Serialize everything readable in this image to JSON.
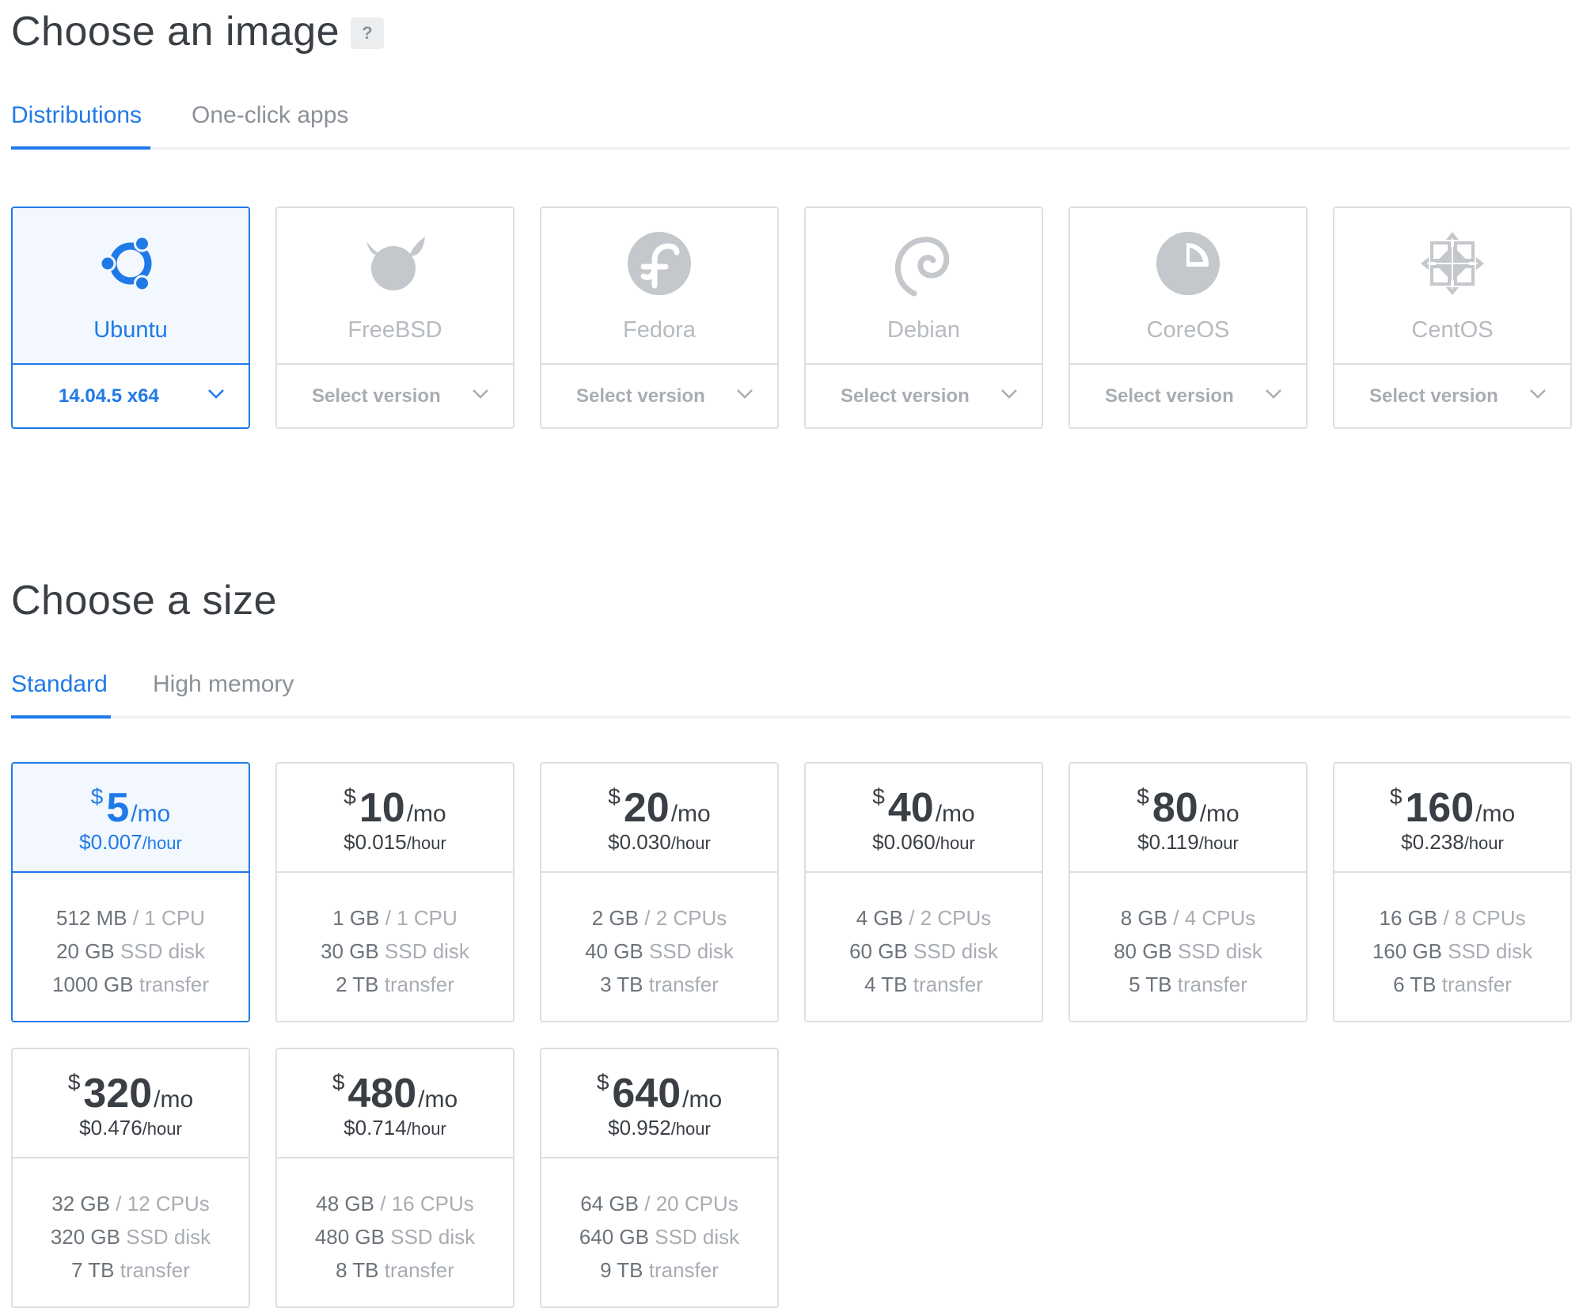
{
  "image_section": {
    "title": "Choose an image",
    "help_label": "?",
    "tabs": [
      {
        "label": "Distributions",
        "active": true
      },
      {
        "label": "One-click apps",
        "active": false
      }
    ],
    "distributions": [
      {
        "name": "Ubuntu",
        "icon": "ubuntu-icon",
        "version": "14.04.5 x64",
        "selected": true
      },
      {
        "name": "FreeBSD",
        "icon": "freebsd-icon",
        "version": "Select version",
        "selected": false
      },
      {
        "name": "Fedora",
        "icon": "fedora-icon",
        "version": "Select version",
        "selected": false
      },
      {
        "name": "Debian",
        "icon": "debian-icon",
        "version": "Select version",
        "selected": false
      },
      {
        "name": "CoreOS",
        "icon": "coreos-icon",
        "version": "Select version",
        "selected": false
      },
      {
        "name": "CentOS",
        "icon": "centos-icon",
        "version": "Select version",
        "selected": false
      }
    ]
  },
  "size_section": {
    "title": "Choose a size",
    "tabs": [
      {
        "label": "Standard",
        "active": true
      },
      {
        "label": "High memory",
        "active": false
      }
    ],
    "currency": "$",
    "per_month": "/mo",
    "per_hour": "/hour",
    "plans": [
      {
        "price": "5",
        "hourly": "$0.007",
        "memory": "512 MB",
        "cpu": "1 CPU",
        "disk": "20 GB",
        "transfer": "1000 GB",
        "selected": true
      },
      {
        "price": "10",
        "hourly": "$0.015",
        "memory": "1 GB",
        "cpu": "1 CPU",
        "disk": "30 GB",
        "transfer": "2 TB",
        "selected": false
      },
      {
        "price": "20",
        "hourly": "$0.030",
        "memory": "2 GB",
        "cpu": "2 CPUs",
        "disk": "40 GB",
        "transfer": "3 TB",
        "selected": false
      },
      {
        "price": "40",
        "hourly": "$0.060",
        "memory": "4 GB",
        "cpu": "2 CPUs",
        "disk": "60 GB",
        "transfer": "4 TB",
        "selected": false
      },
      {
        "price": "80",
        "hourly": "$0.119",
        "memory": "8 GB",
        "cpu": "4 CPUs",
        "disk": "80 GB",
        "transfer": "5 TB",
        "selected": false
      },
      {
        "price": "160",
        "hourly": "$0.238",
        "memory": "16 GB",
        "cpu": "8 CPUs",
        "disk": "160 GB",
        "transfer": "6 TB",
        "selected": false
      },
      {
        "price": "320",
        "hourly": "$0.476",
        "memory": "32 GB",
        "cpu": "12 CPUs",
        "disk": "320 GB",
        "transfer": "7 TB",
        "selected": false
      },
      {
        "price": "480",
        "hourly": "$0.714",
        "memory": "48 GB",
        "cpu": "16 CPUs",
        "disk": "480 GB",
        "transfer": "8 TB",
        "selected": false
      },
      {
        "price": "640",
        "hourly": "$0.952",
        "memory": "64 GB",
        "cpu": "20 CPUs",
        "disk": "640 GB",
        "transfer": "9 TB",
        "selected": false
      }
    ],
    "disk_suffix": "SSD disk",
    "transfer_suffix": "transfer",
    "spec_separator": "/"
  },
  "colors": {
    "accent": "#1f7ae8",
    "selected_bg": "#f3f8fe",
    "border": "#dcdfe3",
    "muted_text": "#a8adb3",
    "icon_gray": "#c4c7cb"
  }
}
